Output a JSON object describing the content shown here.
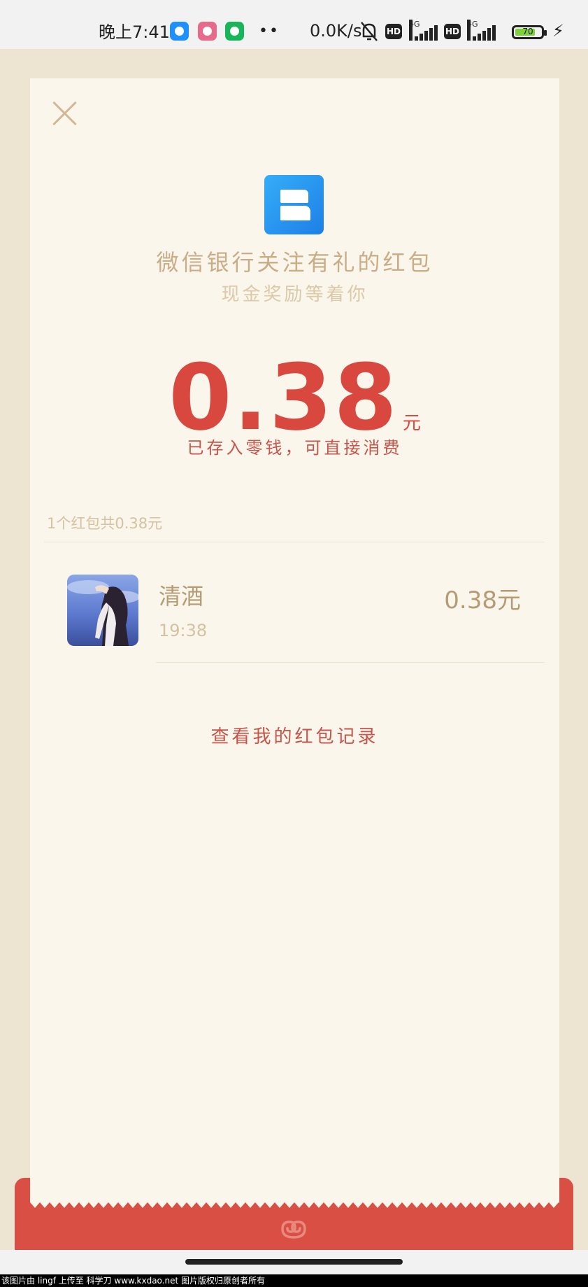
{
  "status_bar": {
    "time": "晚上7:41",
    "dots": "••",
    "speed": "0.0K/s",
    "hd_label": "HD",
    "network": "4G",
    "battery_level": "70"
  },
  "header": {
    "title": "微信银行关注有礼的红包",
    "subtitle": "现金奖励等着你"
  },
  "amount": {
    "value": "0.38",
    "unit": "元",
    "status": "已存入零钱，可直接消费"
  },
  "summary": "1个红包共0.38元",
  "records": [
    {
      "name": "清酒",
      "time": "19:38",
      "amount": "0.38元"
    }
  ],
  "link": {
    "label": "查看我的红包记录"
  },
  "watermark": "该图片由 lingf 上传至 科学刀 www.kxdao.net 图片版权归原创者所有",
  "colors": {
    "accent_red": "#d9483f",
    "gold": "#c9ad86",
    "card_bg": "#faf6ec",
    "page_bg": "#ede4d2"
  },
  "icons": [
    "close-icon",
    "bank-logo-icon",
    "envelope-swirl-icon",
    "bell-mute-icon",
    "signal-icon",
    "battery-icon",
    "charging-icon"
  ]
}
